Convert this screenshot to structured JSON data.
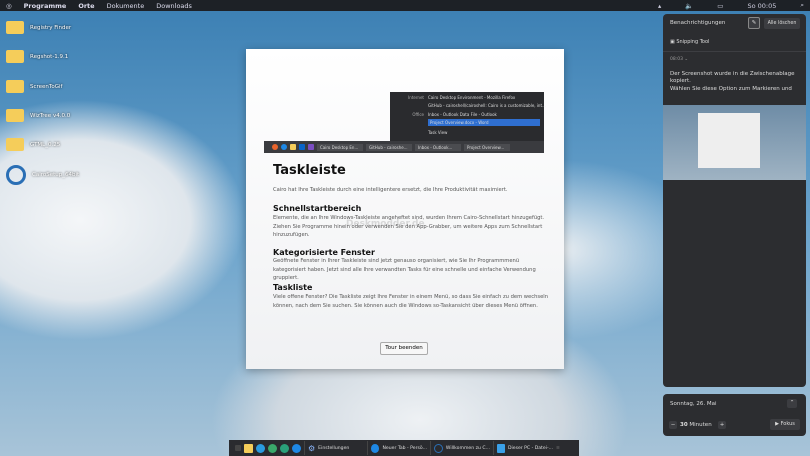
{
  "menubar": {
    "items": [
      "Programme",
      "Orte",
      "Dokumente",
      "Downloads"
    ],
    "clock": "So 00:05"
  },
  "desktop": [
    "Registry Finder",
    "Regshot-1.9.1",
    "ScreenToGif",
    "WizTree v4.0.0",
    "GTML_0.25",
    "CairoSetup_64bit"
  ],
  "preview": {
    "menu": [
      {
        "cat": "Internet",
        "item": "Cairo Desktop Environment - Mozilla Firefox"
      },
      {
        "cat": "",
        "item": "GitHub - cairoshell/cairoshell: Cairo is a customizable, int..."
      },
      {
        "cat": "Office",
        "item": "Inbox - Outlook Data File - Outlook"
      },
      {
        "cat": "",
        "item": "Project Overview.docx - Word"
      },
      {
        "cat": "",
        "item": "Task View"
      }
    ],
    "windows": [
      "Cairo Desktop En...",
      "GitHub - cairoshe...",
      "Inbox - Outlook...",
      "Project Overview..."
    ]
  },
  "dialog": {
    "title": "Taskleiste",
    "intro": "Cairo hat Ihre Taskleiste durch eine intelligentere ersetzt, die Ihre Produktivität maximiert.",
    "sections": [
      {
        "h": "Schnellstartbereich",
        "t": "Elemente, die an Ihre Windows-Taskleiste angeheftet sind, wurden Ihrem Cairo-Schnellstart hinzugefügt. Ziehen Sie Programme hinein oder verwenden Sie den App-Grabber, um weitere Apps zum Schnellstart hinzuzufügen."
      },
      {
        "h": "Kategorisierte Fenster",
        "t": "Geöffnete Fenster in Ihrer Taskleiste sind jetzt genauso organisiert, wie Sie Ihr Programmmenü kategorisiert haben. Jetzt sind alle Ihre verwandten Tasks für eine schnelle und einfache Verwendung gruppiert."
      },
      {
        "h": "Taskliste",
        "t": "Viele offene Fenster? Die Taskliste zeigt Ihre Fenster in einem Menü, so dass Sie einfach zu dem wechseln können, nach dem Sie suchen. Sie können auch die Windows so-Taskansicht über dieses Menü öffnen."
      }
    ],
    "button": "Tour beenden",
    "watermark": "Deskmodder.de"
  },
  "notifications": {
    "title": "Benachrichtigungen",
    "clear": "Alle löschen",
    "app": "Snipping Tool",
    "time": "08:03",
    "heading": "Der Screenshot wurde in die Zwischenablage kopiert.",
    "body": "Wählen Sie diese Option zum Markieren und"
  },
  "calendar": {
    "date": "Sonntag, 26. Mai",
    "minutes": "30",
    "unit": "Minuten",
    "focus": "Fokus"
  },
  "taskbar": {
    "windows": [
      "Einstellungen",
      "Neuer Tab - Persö...",
      "Willkommen zu C...",
      "Dieser PC - Datei-..."
    ]
  }
}
